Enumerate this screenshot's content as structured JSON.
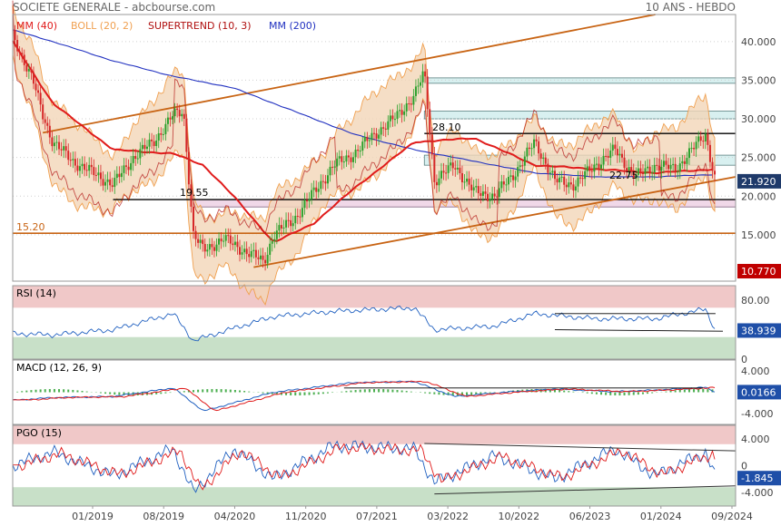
{
  "header": {
    "title": "SOCIETE GENERALE - abcbourse.com",
    "period": "10 ANS - HEBDO"
  },
  "colors": {
    "ma40": "#e01b1b",
    "boll": "#f0a050",
    "boll_fill": "#f3d6b8",
    "supertrend": "#b01010",
    "ma200": "#2030c0",
    "price_up": "#2ca02c",
    "price_down": "#d62728",
    "trendline": "#c86414",
    "rsi": "#2060c0",
    "macd": "#2060c0",
    "signal": "#e01b1b",
    "histogram": "#4caf50",
    "overbought_zone": "#f0c8c8",
    "oversold_zone": "#c8e0c8",
    "last_price_bg": "#c00000",
    "indicator_value_bg": "#1f4fa8",
    "resistance_zone": "#d8f0f0",
    "support_zone": "#f0d8e8"
  },
  "chart_data": [
    {
      "type": "candlestick",
      "panel": "price",
      "legend": [
        {
          "label": "MM (40)",
          "color": "#e01b1b"
        },
        {
          "label": "BOLL (20, 2)",
          "color": "#f0a050"
        },
        {
          "label": "SUPERTREND (10, 3)",
          "color": "#b01010"
        },
        {
          "label": "MM (200)",
          "color": "#2030c0"
        }
      ],
      "x_ticks": [
        "01/2019",
        "08/2019",
        "04/2020",
        "11/2020",
        "07/2021",
        "03/2022",
        "10/2022",
        "06/2023",
        "01/2024",
        "09/2024"
      ],
      "y_ticks": [
        15,
        20,
        25,
        30,
        35,
        40
      ],
      "y_tick_labels": [
        "15.000",
        "20.000",
        "25.000",
        "30.000",
        "35.000",
        "40.000"
      ],
      "ylim": [
        9.0,
        43.5
      ],
      "last_price": "21.920",
      "low_marker": "10.770",
      "close_series": [
        {
          "date": "2018-09",
          "value": 40.8
        },
        {
          "date": "2018-11",
          "value": 35.0
        },
        {
          "date": "2018-12",
          "value": 30.5
        },
        {
          "date": "2019-01",
          "value": 27.0
        },
        {
          "date": "2019-03",
          "value": 24.5
        },
        {
          "date": "2019-05",
          "value": 23.0
        },
        {
          "date": "2019-07",
          "value": 21.5
        },
        {
          "date": "2019-09",
          "value": 25.0
        },
        {
          "date": "2019-11",
          "value": 27.0
        },
        {
          "date": "2020-01",
          "value": 30.5
        },
        {
          "date": "2020-02",
          "value": 31.0
        },
        {
          "date": "2020-03",
          "value": 15.0
        },
        {
          "date": "2020-04",
          "value": 13.0
        },
        {
          "date": "2020-06",
          "value": 14.5
        },
        {
          "date": "2020-08",
          "value": 13.0
        },
        {
          "date": "2020-10",
          "value": 11.5
        },
        {
          "date": "2020-11",
          "value": 15.0
        },
        {
          "date": "2021-01",
          "value": 17.0
        },
        {
          "date": "2021-03",
          "value": 20.5
        },
        {
          "date": "2021-05",
          "value": 24.0
        },
        {
          "date": "2021-07",
          "value": 25.5
        },
        {
          "date": "2021-09",
          "value": 28.0
        },
        {
          "date": "2021-11",
          "value": 30.0
        },
        {
          "date": "2022-01",
          "value": 33.0
        },
        {
          "date": "2022-02",
          "value": 36.0
        },
        {
          "date": "2022-03",
          "value": 22.0
        },
        {
          "date": "2022-05",
          "value": 24.0
        },
        {
          "date": "2022-07",
          "value": 20.5
        },
        {
          "date": "2022-09",
          "value": 20.0
        },
        {
          "date": "2022-11",
          "value": 23.0
        },
        {
          "date": "2023-01",
          "value": 27.0
        },
        {
          "date": "2023-03",
          "value": 22.0
        },
        {
          "date": "2023-05",
          "value": 21.5
        },
        {
          "date": "2023-07",
          "value": 24.0
        },
        {
          "date": "2023-09",
          "value": 26.0
        },
        {
          "date": "2023-11",
          "value": 22.5
        },
        {
          "date": "2024-01",
          "value": 24.0
        },
        {
          "date": "2024-03",
          "value": 23.5
        },
        {
          "date": "2024-05",
          "value": 26.5
        },
        {
          "date": "2024-06",
          "value": 28.0
        },
        {
          "date": "2024-07",
          "value": 21.9
        }
      ],
      "ma200_series": [
        {
          "date": "2018-09",
          "value": 41.5
        },
        {
          "date": "2019-01",
          "value": 40.0
        },
        {
          "date": "2019-07",
          "value": 37.5
        },
        {
          "date": "2020-01",
          "value": 35.5
        },
        {
          "date": "2020-07",
          "value": 34.0
        },
        {
          "date": "2021-01",
          "value": 31.0
        },
        {
          "date": "2021-07",
          "value": 28.0
        },
        {
          "date": "2022-01",
          "value": 26.0
        },
        {
          "date": "2022-07",
          "value": 24.5
        },
        {
          "date": "2023-01",
          "value": 23.0
        },
        {
          "date": "2023-07",
          "value": 22.5
        },
        {
          "date": "2024-01",
          "value": 22.5
        },
        {
          "date": "2024-07",
          "value": 22.8
        }
      ],
      "ma40_series": [
        {
          "date": "2018-09",
          "value": 40.0
        },
        {
          "date": "2019-01",
          "value": 32.0
        },
        {
          "date": "2019-07",
          "value": 26.0
        },
        {
          "date": "2020-01",
          "value": 25.5
        },
        {
          "date": "2020-04",
          "value": 24.0
        },
        {
          "date": "2020-07",
          "value": 20.0
        },
        {
          "date": "2020-11",
          "value": 14.0
        },
        {
          "date": "2021-03",
          "value": 16.5
        },
        {
          "date": "2021-07",
          "value": 21.0
        },
        {
          "date": "2022-01",
          "value": 27.0
        },
        {
          "date": "2022-07",
          "value": 27.5
        },
        {
          "date": "2023-01",
          "value": 24.0
        },
        {
          "date": "2023-07",
          "value": 23.5
        },
        {
          "date": "2024-01",
          "value": 23.0
        },
        {
          "date": "2024-07",
          "value": 23.5
        }
      ],
      "annotations": [
        {
          "text": "15.20",
          "value": 15.2
        },
        {
          "text": "19.55",
          "value": 19.55
        },
        {
          "text": "28.10",
          "value": 28.1
        },
        {
          "text": "22.75",
          "value": 22.75
        }
      ],
      "horizontal_levels": [
        15.2,
        19.55,
        28.1
      ],
      "resistance_zones": [
        [
          34.6,
          35.3
        ],
        [
          30.0,
          31.0
        ],
        [
          24.0,
          25.3
        ]
      ],
      "support_zone": [
        18.6,
        19.55
      ]
    },
    {
      "type": "line",
      "panel": "rsi",
      "title": "RSI (14)",
      "y_ticks": [
        0,
        40,
        80
      ],
      "y_tick_labels": [
        "0",
        "40",
        "80.00"
      ],
      "ylim": [
        0,
        100
      ],
      "overbought": 70,
      "oversold": 30,
      "last_value": "38.939",
      "series": [
        {
          "date": "2018-09",
          "value": 35
        },
        {
          "date": "2019-01",
          "value": 33
        },
        {
          "date": "2019-07",
          "value": 40
        },
        {
          "date": "2020-01",
          "value": 62
        },
        {
          "date": "2020-03",
          "value": 25
        },
        {
          "date": "2020-07",
          "value": 42
        },
        {
          "date": "2020-11",
          "value": 58
        },
        {
          "date": "2021-05",
          "value": 65
        },
        {
          "date": "2022-01",
          "value": 70
        },
        {
          "date": "2022-03",
          "value": 40
        },
        {
          "date": "2022-09",
          "value": 45
        },
        {
          "date": "2023-01",
          "value": 62
        },
        {
          "date": "2023-07",
          "value": 55
        },
        {
          "date": "2024-01",
          "value": 55
        },
        {
          "date": "2024-06",
          "value": 68
        },
        {
          "date": "2024-07",
          "value": 38.9
        }
      ]
    },
    {
      "type": "line",
      "panel": "macd",
      "title": "MACD (12, 26, 9)",
      "y_ticks": [
        -4,
        0,
        4
      ],
      "y_tick_labels": [
        "-4.000",
        "0",
        "4.000"
      ],
      "ylim": [
        -6,
        6
      ],
      "last_value": "0.0166",
      "series": [
        {
          "name": "MACD",
          "points": [
            {
              "date": "2018-09",
              "value": -1.5
            },
            {
              "date": "2019-01",
              "value": -1.0
            },
            {
              "date": "2019-07",
              "value": -0.8
            },
            {
              "date": "2020-01",
              "value": 0.8
            },
            {
              "date": "2020-04",
              "value": -3.5
            },
            {
              "date": "2020-07",
              "value": -2.0
            },
            {
              "date": "2020-11",
              "value": 0.0
            },
            {
              "date": "2021-07",
              "value": 1.8
            },
            {
              "date": "2022-01",
              "value": 2.0
            },
            {
              "date": "2022-05",
              "value": -0.8
            },
            {
              "date": "2022-10",
              "value": 0.0
            },
            {
              "date": "2023-03",
              "value": 0.6
            },
            {
              "date": "2023-09",
              "value": 0.1
            },
            {
              "date": "2024-01",
              "value": 0.4
            },
            {
              "date": "2024-06",
              "value": 0.9
            },
            {
              "date": "2024-07",
              "value": 0.02
            }
          ]
        }
      ]
    },
    {
      "type": "line",
      "panel": "pgo",
      "title": "PGO (15)",
      "y_ticks": [
        -4,
        0,
        4
      ],
      "y_tick_labels": [
        "-4.000",
        "0",
        "4.000"
      ],
      "ylim": [
        -6,
        6
      ],
      "last_value": "-1.845",
      "series": [
        {
          "date": "2018-09",
          "value": 0
        },
        {
          "date": "2019-01",
          "value": 2
        },
        {
          "date": "2019-07",
          "value": -1.5
        },
        {
          "date": "2020-01",
          "value": 2.5
        },
        {
          "date": "2020-03",
          "value": -4
        },
        {
          "date": "2020-07",
          "value": 2.5
        },
        {
          "date": "2020-11",
          "value": -2
        },
        {
          "date": "2021-05",
          "value": 3
        },
        {
          "date": "2022-01",
          "value": 2.5
        },
        {
          "date": "2022-03",
          "value": -2.5
        },
        {
          "date": "2022-09",
          "value": 1.5
        },
        {
          "date": "2023-03",
          "value": -2
        },
        {
          "date": "2023-09",
          "value": 2.5
        },
        {
          "date": "2024-01",
          "value": -1.5
        },
        {
          "date": "2024-06",
          "value": 2.0
        },
        {
          "date": "2024-07",
          "value": -1.845
        }
      ]
    }
  ]
}
